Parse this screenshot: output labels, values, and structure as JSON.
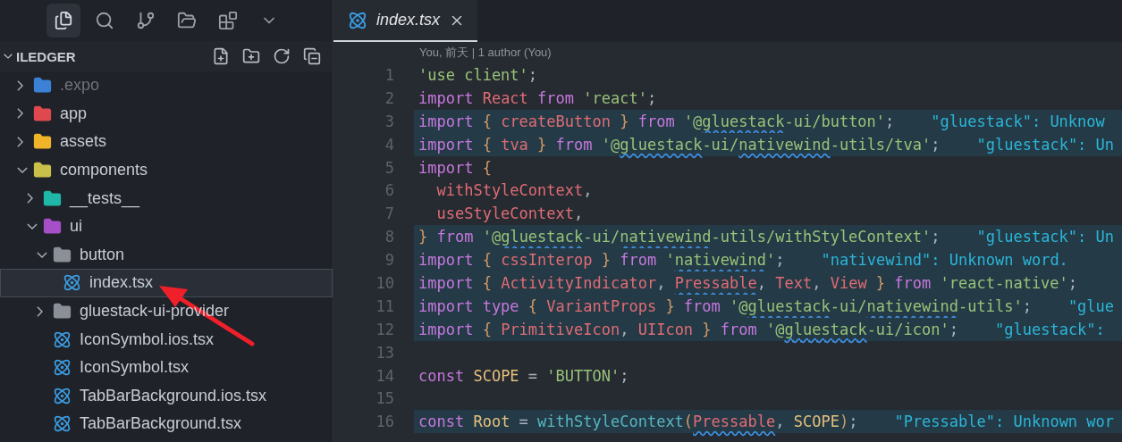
{
  "activity_bar": [
    {
      "kind": "files",
      "selected": true
    },
    {
      "kind": "search",
      "selected": false
    },
    {
      "kind": "branch",
      "selected": false
    },
    {
      "kind": "folder",
      "selected": false
    },
    {
      "kind": "blocks",
      "selected": false
    },
    {
      "kind": "more",
      "selected": false
    }
  ],
  "explorer": {
    "title": "ILEDGER",
    "expanded": true,
    "actions": [
      {
        "kind": "new-file"
      },
      {
        "kind": "new-folder"
      },
      {
        "kind": "refresh"
      },
      {
        "kind": "collapse"
      }
    ],
    "tree": [
      {
        "kind": "folder",
        "label": ".expo",
        "color": "#3b82d6",
        "expanded": false,
        "dimmed": true,
        "selected": false
      },
      {
        "kind": "folder",
        "label": "app",
        "color": "#e0484f",
        "expanded": false,
        "dimmed": false,
        "selected": false
      },
      {
        "kind": "folder",
        "label": "assets",
        "color": "#f0b429",
        "expanded": false,
        "dimmed": false,
        "selected": false
      },
      {
        "kind": "folder",
        "label": "components",
        "color": "#c9c04a",
        "expanded": true,
        "dimmed": false,
        "selected": false,
        "children": [
          {
            "kind": "folder",
            "label": "__tests__",
            "color": "#1fb8a8",
            "expanded": false,
            "dimmed": false,
            "selected": false
          },
          {
            "kind": "folder",
            "label": "ui",
            "color": "#a64fc9",
            "expanded": true,
            "dimmed": false,
            "selected": false,
            "children": [
              {
                "kind": "folder",
                "label": "button",
                "color": "#8a8f98",
                "expanded": true,
                "dimmed": false,
                "selected": false,
                "children": [
                  {
                    "kind": "file",
                    "label": "index.tsx",
                    "dimmed": false,
                    "selected": true
                  }
                ]
              },
              {
                "kind": "folder",
                "label": "gluestack-ui-provider",
                "color": "#8a8f98",
                "expanded": false,
                "dimmed": false,
                "selected": false
              },
              {
                "kind": "file",
                "label": "IconSymbol.ios.tsx",
                "dimmed": false,
                "selected": false
              },
              {
                "kind": "file",
                "label": "IconSymbol.tsx",
                "dimmed": false,
                "selected": false
              },
              {
                "kind": "file",
                "label": "TabBarBackground.ios.tsx",
                "dimmed": false,
                "selected": false
              },
              {
                "kind": "file",
                "label": "TabBarBackground.tsx",
                "dimmed": false,
                "selected": false
              }
            ]
          }
        ]
      }
    ]
  },
  "tabs": [
    {
      "label": "index.tsx",
      "selected": true
    }
  ],
  "codelens": "You, 前天 | 1 author (You)",
  "lines": [
    {
      "number": "1",
      "highlighted": false,
      "tokens": [
        {
          "kind": "string",
          "text": "'use client'"
        },
        {
          "kind": "punct",
          "text": ";"
        }
      ]
    },
    {
      "number": "2",
      "highlighted": false,
      "tokens": [
        {
          "kind": "keyword",
          "text": "import "
        },
        {
          "kind": "ident",
          "text": "React "
        },
        {
          "kind": "keyword",
          "text": "from "
        },
        {
          "kind": "string",
          "text": "'react'"
        },
        {
          "kind": "punct",
          "text": ";"
        }
      ]
    },
    {
      "number": "3",
      "highlighted": true,
      "hint": "\"gluestack\": Unknow",
      "tokens": [
        {
          "kind": "keyword",
          "text": "import "
        },
        {
          "kind": "brace",
          "text": "{ "
        },
        {
          "kind": "ident",
          "text": "createButton "
        },
        {
          "kind": "brace",
          "text": "} "
        },
        {
          "kind": "keyword",
          "text": "from "
        },
        {
          "kind": "string",
          "text": "'@"
        },
        {
          "kind": "string",
          "text": "gluestack",
          "squiggle": true
        },
        {
          "kind": "string",
          "text": "-ui/button'"
        },
        {
          "kind": "punct",
          "text": ";"
        }
      ]
    },
    {
      "number": "4",
      "highlighted": true,
      "hint": "\"gluestack\": Un",
      "tokens": [
        {
          "kind": "keyword",
          "text": "import "
        },
        {
          "kind": "brace",
          "text": "{ "
        },
        {
          "kind": "ident",
          "text": "tva "
        },
        {
          "kind": "brace",
          "text": "} "
        },
        {
          "kind": "keyword",
          "text": "from "
        },
        {
          "kind": "string",
          "text": "'@"
        },
        {
          "kind": "string",
          "text": "gluestack",
          "squiggle": true
        },
        {
          "kind": "string",
          "text": "-ui/"
        },
        {
          "kind": "string",
          "text": "nativewind",
          "squiggle": true
        },
        {
          "kind": "string",
          "text": "-utils/tva'"
        },
        {
          "kind": "punct",
          "text": ";"
        }
      ]
    },
    {
      "number": "5",
      "highlighted": false,
      "tokens": [
        {
          "kind": "keyword",
          "text": "import "
        },
        {
          "kind": "brace",
          "text": "{"
        }
      ]
    },
    {
      "number": "6",
      "highlighted": false,
      "tokens": [
        {
          "kind": "ident",
          "text": "  withStyleContext"
        },
        {
          "kind": "punct",
          "text": ","
        }
      ]
    },
    {
      "number": "7",
      "highlighted": false,
      "tokens": [
        {
          "kind": "ident",
          "text": "  useStyleContext"
        },
        {
          "kind": "punct",
          "text": ","
        }
      ]
    },
    {
      "number": "8",
      "highlighted": true,
      "hint": "\"gluestack\": Un",
      "tokens": [
        {
          "kind": "brace",
          "text": "} "
        },
        {
          "kind": "keyword",
          "text": "from "
        },
        {
          "kind": "string",
          "text": "'@"
        },
        {
          "kind": "string",
          "text": "gluestack",
          "squiggle": true
        },
        {
          "kind": "string",
          "text": "-ui/"
        },
        {
          "kind": "string",
          "text": "nativewind",
          "squiggle": true
        },
        {
          "kind": "string",
          "text": "-utils/withStyleContext'"
        },
        {
          "kind": "punct",
          "text": ";"
        }
      ]
    },
    {
      "number": "9",
      "highlighted": true,
      "hint": "\"nativewind\": Unknown word.",
      "tokens": [
        {
          "kind": "keyword",
          "text": "import "
        },
        {
          "kind": "brace",
          "text": "{ "
        },
        {
          "kind": "ident",
          "text": "cssInterop "
        },
        {
          "kind": "brace",
          "text": "} "
        },
        {
          "kind": "keyword",
          "text": "from "
        },
        {
          "kind": "string",
          "text": "'"
        },
        {
          "kind": "string",
          "text": "nativewind",
          "squiggle": true
        },
        {
          "kind": "string",
          "text": "'"
        },
        {
          "kind": "punct",
          "text": ";"
        }
      ]
    },
    {
      "number": "10",
      "highlighted": true,
      "tokens": [
        {
          "kind": "keyword",
          "text": "import "
        },
        {
          "kind": "brace",
          "text": "{ "
        },
        {
          "kind": "ident",
          "text": "ActivityIndicator"
        },
        {
          "kind": "punct",
          "text": ", "
        },
        {
          "kind": "ident",
          "text": "Pressable",
          "squiggle": true
        },
        {
          "kind": "punct",
          "text": ", "
        },
        {
          "kind": "ident",
          "text": "Text"
        },
        {
          "kind": "punct",
          "text": ", "
        },
        {
          "kind": "ident",
          "text": "View "
        },
        {
          "kind": "brace",
          "text": "} "
        },
        {
          "kind": "keyword",
          "text": "from "
        },
        {
          "kind": "string",
          "text": "'react-native'"
        },
        {
          "kind": "punct",
          "text": ";"
        }
      ]
    },
    {
      "number": "11",
      "highlighted": true,
      "hint": "\"glue",
      "tokens": [
        {
          "kind": "keyword",
          "text": "import type "
        },
        {
          "kind": "brace",
          "text": "{ "
        },
        {
          "kind": "ident",
          "text": "VariantProps "
        },
        {
          "kind": "brace",
          "text": "} "
        },
        {
          "kind": "keyword",
          "text": "from "
        },
        {
          "kind": "string",
          "text": "'@"
        },
        {
          "kind": "string",
          "text": "gluestack",
          "squiggle": true
        },
        {
          "kind": "string",
          "text": "-ui/"
        },
        {
          "kind": "string",
          "text": "nativewind",
          "squiggle": true
        },
        {
          "kind": "string",
          "text": "-utils'"
        },
        {
          "kind": "punct",
          "text": ";"
        }
      ]
    },
    {
      "number": "12",
      "highlighted": true,
      "hint": "\"gluestack\":",
      "tokens": [
        {
          "kind": "keyword",
          "text": "import "
        },
        {
          "kind": "brace",
          "text": "{ "
        },
        {
          "kind": "ident",
          "text": "PrimitiveIcon"
        },
        {
          "kind": "punct",
          "text": ", "
        },
        {
          "kind": "ident",
          "text": "UIIcon "
        },
        {
          "kind": "brace",
          "text": "} "
        },
        {
          "kind": "keyword",
          "text": "from "
        },
        {
          "kind": "string",
          "text": "'@"
        },
        {
          "kind": "string",
          "text": "gluestack",
          "squiggle": true
        },
        {
          "kind": "string",
          "text": "-ui/icon'"
        },
        {
          "kind": "punct",
          "text": ";"
        }
      ]
    },
    {
      "number": "13",
      "highlighted": false
    },
    {
      "number": "14",
      "highlighted": false,
      "tokens": [
        {
          "kind": "keyword",
          "text": "const "
        },
        {
          "kind": "constant",
          "text": "SCOPE "
        },
        {
          "kind": "punct",
          "text": "= "
        },
        {
          "kind": "string",
          "text": "'BUTTON'"
        },
        {
          "kind": "punct",
          "text": ";"
        }
      ]
    },
    {
      "number": "15",
      "highlighted": false
    },
    {
      "number": "16",
      "highlighted": true,
      "hint": "\"Pressable\": Unknown wor",
      "tokens": [
        {
          "kind": "keyword",
          "text": "const "
        },
        {
          "kind": "constant",
          "text": "Root "
        },
        {
          "kind": "punct",
          "text": "= "
        },
        {
          "kind": "func",
          "text": "withStyleContext"
        },
        {
          "kind": "brace",
          "text": "("
        },
        {
          "kind": "ident",
          "text": "Pressable",
          "squiggle": true
        },
        {
          "kind": "punct",
          "text": ", "
        },
        {
          "kind": "constant",
          "text": "SCOPE"
        },
        {
          "kind": "brace",
          "text": ")"
        },
        {
          "kind": "punct",
          "text": ";"
        }
      ]
    }
  ],
  "annotation": {
    "kind": "arrow"
  }
}
